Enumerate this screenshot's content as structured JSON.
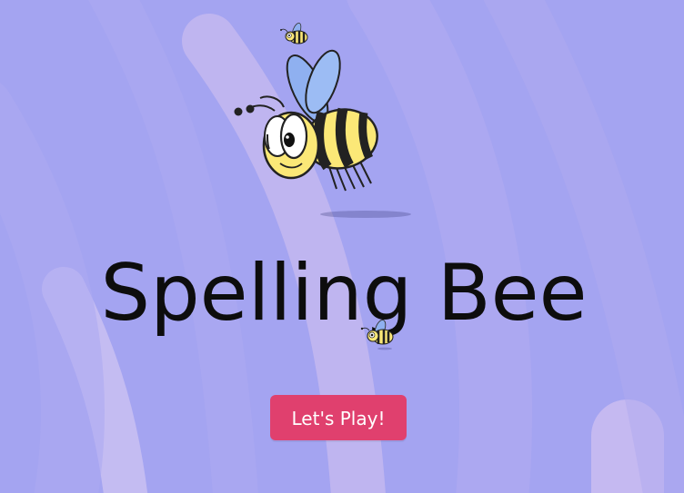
{
  "game": {
    "title": "Spelling Bee",
    "play_button": "Let's Play!"
  },
  "colors": {
    "background": "#a4a4f1",
    "stripe": "#bcb4ee",
    "button": "#e0406e",
    "bee_yellow": "#fbe877",
    "wing": "#8fb0f0"
  },
  "icons": [
    "bee-icon",
    "bee-icon",
    "bee-icon"
  ]
}
